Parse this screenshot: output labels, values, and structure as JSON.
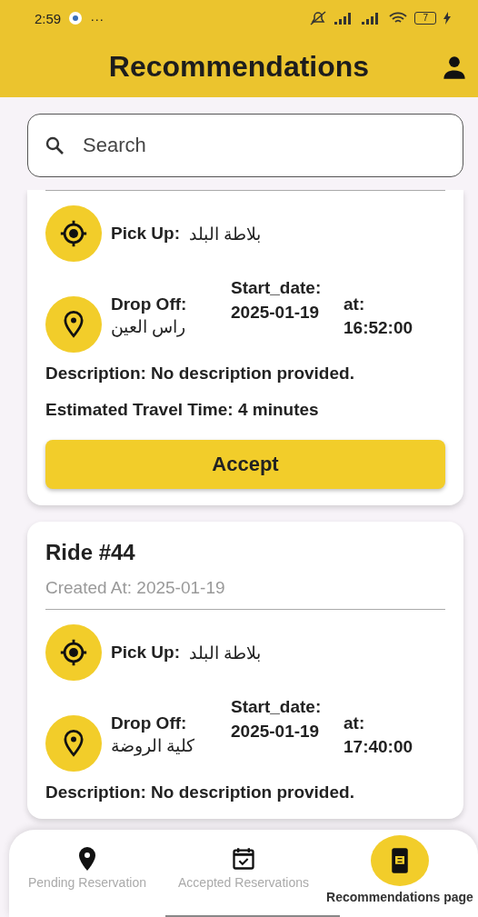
{
  "status_bar": {
    "time": "2:59",
    "more": "···",
    "battery": "7"
  },
  "header": {
    "title": "Recommendations"
  },
  "search": {
    "placeholder": "Search"
  },
  "rides": [
    {
      "title_visible": false,
      "pickup_label": "Pick Up:",
      "pickup": "بلاطة البلد",
      "dropoff_label": "Drop Off:",
      "dropoff": "راس العين",
      "start_label": "Start_date:",
      "start_date": "2025-01-19",
      "at_label": "at:",
      "time": "16:52:00",
      "description": "Description: No description provided.",
      "estimate": "Estimated Travel Time: 4 minutes",
      "button": "Accept"
    },
    {
      "title_visible": true,
      "title": "Ride #44",
      "created": "Created At: 2025-01-19",
      "pickup_label": "Pick Up:",
      "pickup": "بلاطة البلد",
      "dropoff_label": "Drop Off:",
      "dropoff": "كلية الروضة",
      "start_label": "Start_date:",
      "start_date": "2025-01-19",
      "at_label": "at:",
      "time": "17:40:00",
      "description": "Description: No description provided."
    }
  ],
  "nav": [
    {
      "kind": "pin",
      "label": "Pending Reservation",
      "selected": false
    },
    {
      "kind": "calendar",
      "label": "Accepted Reservations",
      "selected": false
    },
    {
      "kind": "phone",
      "label": "Recommendations page",
      "selected": true
    }
  ]
}
